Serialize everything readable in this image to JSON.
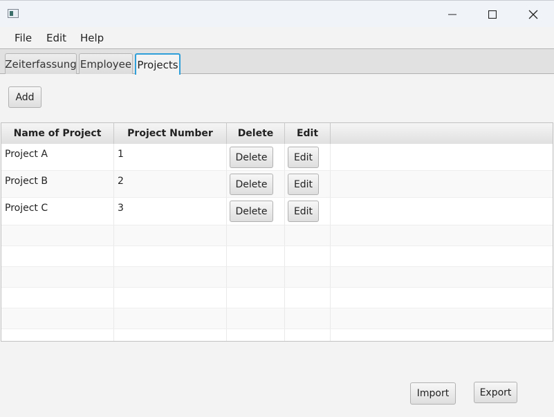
{
  "window": {
    "icons": {
      "app": "app-window-icon",
      "minimize": "minimize-icon",
      "maximize": "maximize-icon",
      "close": "close-icon"
    }
  },
  "menubar": {
    "items": [
      {
        "label": "File"
      },
      {
        "label": "Edit"
      },
      {
        "label": "Help"
      }
    ]
  },
  "tabs": [
    {
      "label": "Zeiterfassung",
      "active": false
    },
    {
      "label": "Employee",
      "active": false
    },
    {
      "label": "Projects",
      "active": true
    }
  ],
  "toolbar": {
    "add_label": "Add"
  },
  "table": {
    "columns": [
      "Name of Project",
      "Project Number",
      "Delete",
      "Edit"
    ],
    "rows": [
      {
        "name": "Project A",
        "number": "1",
        "delete_label": "Delete",
        "edit_label": "Edit"
      },
      {
        "name": "Project B",
        "number": "2",
        "delete_label": "Delete",
        "edit_label": "Edit"
      },
      {
        "name": "Project C",
        "number": "3",
        "delete_label": "Delete",
        "edit_label": "Edit"
      }
    ]
  },
  "footer": {
    "import_label": "Import",
    "export_label": "Export"
  },
  "colors": {
    "active_tab_border": "#2e9fd8"
  }
}
